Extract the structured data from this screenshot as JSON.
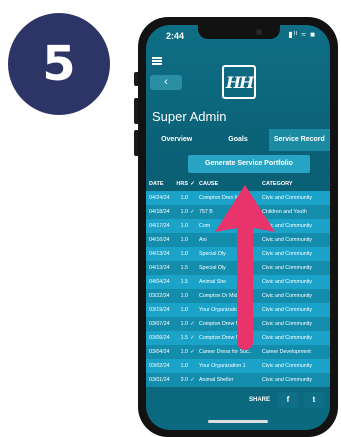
{
  "step_number": "5",
  "status_bar": {
    "time": "2:44",
    "icons": "▮ᴵᴵ ≈ ■"
  },
  "nav": {
    "back_label": "‹",
    "logo_text": "HH"
  },
  "user_name": "Super Admin",
  "tabs": [
    {
      "label": "Overview",
      "active": false
    },
    {
      "label": "Goals",
      "active": false
    },
    {
      "label": "Service Record",
      "active": true
    }
  ],
  "generate_button_label": "Generate Service Portfolio",
  "table": {
    "headers": {
      "date": "DATE",
      "hrs": "HRS",
      "check": "✓",
      "cause": "CAUSE",
      "category": "CATEGORY"
    },
    "rows": [
      {
        "date": "04/24/24",
        "hrs": "1.0",
        "check": "",
        "cause": "Compton Dren Middl..",
        "category": "Civic and Community"
      },
      {
        "date": "04/18/24",
        "hrs": "1.0",
        "check": "✓",
        "cause": "757 B",
        "category": "Children and Youth"
      },
      {
        "date": "04/17/24",
        "hrs": "1.0",
        "check": "",
        "cause": "Com",
        "category": "Civic and Community"
      },
      {
        "date": "04/16/24",
        "hrs": "1.0",
        "check": "",
        "cause": "Ani",
        "category": "Civic and Community"
      },
      {
        "date": "04/13/24",
        "hrs": "1.0",
        "check": "",
        "cause": "Special Oly",
        "category": "Civic and Community"
      },
      {
        "date": "04/13/24",
        "hrs": "1.5",
        "check": "",
        "cause": "Special Oly",
        "category": "Civic and Community"
      },
      {
        "date": "04/04/24",
        "hrs": "1.5",
        "check": "",
        "cause": "Animal She",
        "category": "Civic and Community"
      },
      {
        "date": "03/22/24",
        "hrs": "1.0",
        "check": "",
        "cause": "Compton Dr   Middl..",
        "category": "Civic and Community"
      },
      {
        "date": "03/19/24",
        "hrs": "1.0",
        "check": "",
        "cause": "Your Organization 1",
        "category": "Civic and Community"
      },
      {
        "date": "03/07/24",
        "hrs": "1.0",
        "check": "✓",
        "cause": "Compton Drew Middl..",
        "category": "Civic and Community"
      },
      {
        "date": "03/06/24",
        "hrs": "1.5",
        "check": "✓",
        "cause": "Compton Drew Middl..",
        "category": "Civic and Community"
      },
      {
        "date": "03/04/24",
        "hrs": "1.0",
        "check": "✓",
        "cause": "Career Dress for Suc..",
        "category": "Career Development"
      },
      {
        "date": "03/02/24",
        "hrs": "1.0",
        "check": "",
        "cause": "Your Organization 1",
        "category": "Civic and Community"
      },
      {
        "date": "03/01/24",
        "hrs": "3.0",
        "check": "✓",
        "cause": "Animal Shelter",
        "category": "Civic and Community"
      }
    ]
  },
  "share": {
    "label": "SHARE",
    "facebook": "f",
    "twitter": "t"
  },
  "colors": {
    "badge": "#2c3566",
    "arrow": "#e8336b",
    "screen": "#0f6f86"
  }
}
